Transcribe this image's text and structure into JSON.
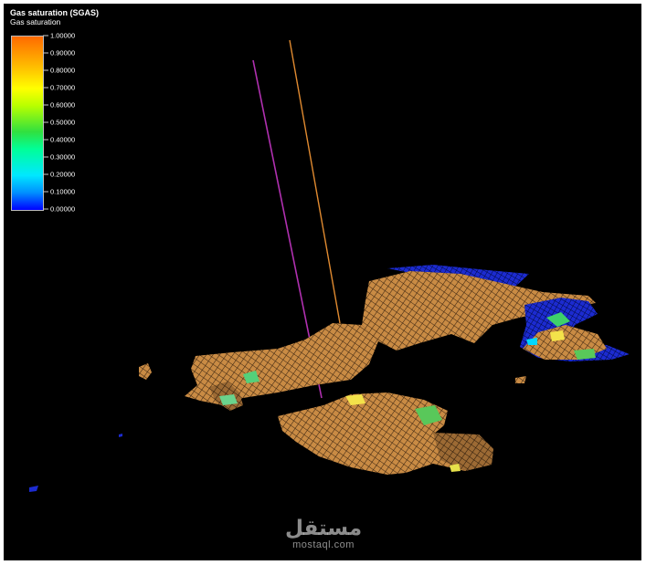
{
  "legend": {
    "title": "Gas saturation (SGAS)",
    "subtitle": "Gas saturation",
    "ticks": [
      "1.00000",
      "0.90000",
      "0.80000",
      "0.70000",
      "0.60000",
      "0.50000",
      "0.40000",
      "0.30000",
      "0.20000",
      "0.10000",
      "0.00000"
    ],
    "colors": [
      "#ff6a00",
      "#ffc000",
      "#ffff00",
      "#b8ff00",
      "#30e040",
      "#00ff98",
      "#00e8ff",
      "#0090ff",
      "#0000ff"
    ]
  },
  "scene": {
    "well_colors": [
      "#b030b0",
      "#e08a30"
    ],
    "dominant_color": "#c88a40"
  },
  "watermark": {
    "arabic": "مستقل",
    "url": "mostaql.com"
  }
}
